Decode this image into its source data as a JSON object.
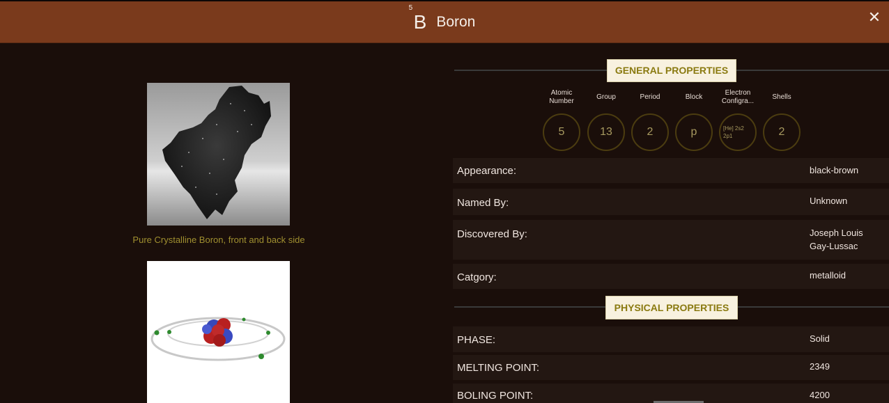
{
  "header": {
    "atomic_number": "5",
    "symbol": "B",
    "name": "Boron"
  },
  "left": {
    "caption": "Pure Crystalline Boron, front and back side"
  },
  "general": {
    "title": "GENERAL PROPERTIES",
    "columns": [
      {
        "label": "Atomic Number",
        "value": "5"
      },
      {
        "label": "Group",
        "value": "13"
      },
      {
        "label": "Period",
        "value": "2"
      },
      {
        "label": "Block",
        "value": "p"
      },
      {
        "label": "Electron Configra...",
        "value": "[He] 2s2 2p1"
      },
      {
        "label": "Shells",
        "value": "2"
      }
    ],
    "rows": [
      {
        "key": "Appearance:",
        "value": "black-brown"
      },
      {
        "key": "Named By:",
        "value": "Unknown"
      },
      {
        "key": "Discovered By:",
        "value": "Joseph Louis Gay-Lussac"
      },
      {
        "key": "Catgory:",
        "value": "metalloid"
      }
    ]
  },
  "physical": {
    "title": "PHYSICAL PROPERTIES",
    "rows": [
      {
        "key": "PHASE:",
        "value": "Solid"
      },
      {
        "key": "MELTING POINT:",
        "value": "2349"
      },
      {
        "key": "BOLING POINT:",
        "value": "4200"
      }
    ]
  }
}
